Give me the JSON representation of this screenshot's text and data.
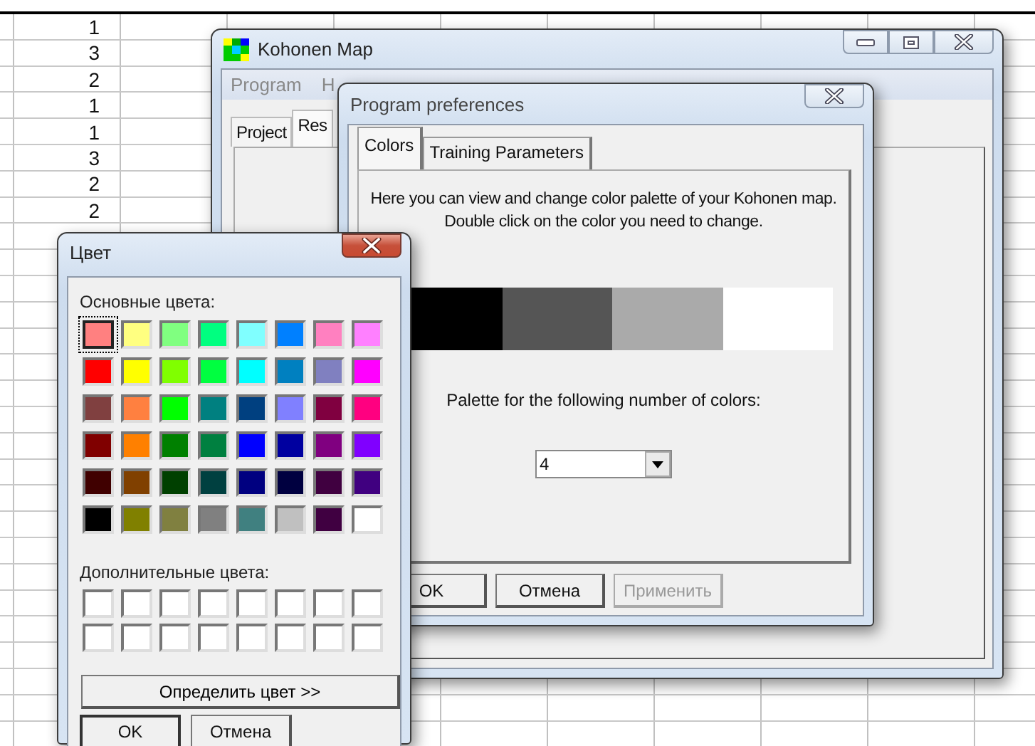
{
  "sheet": {
    "cells": [
      "1",
      "3",
      "2",
      "1",
      "1",
      "3",
      "2",
      "2"
    ]
  },
  "main_window": {
    "title": "Kohonen Map",
    "menu": [
      {
        "label": "Program"
      },
      {
        "label": "H"
      }
    ],
    "tabs": [
      {
        "label": "Project",
        "selected": false
      },
      {
        "label": "Res",
        "selected": true
      }
    ]
  },
  "preferences": {
    "title": "Program preferences",
    "tabs": [
      {
        "label": "Colors",
        "selected": true
      },
      {
        "label": "Training Parameters",
        "selected": false
      }
    ],
    "description": "Here you can view and change color palette of your Kohonen map. Double click on the color you need to change.",
    "palette": [
      {
        "color": "#000000"
      },
      {
        "color": "#555555"
      },
      {
        "color": "#aaaaaa"
      },
      {
        "color": "#ffffff"
      }
    ],
    "count_label": "Palette for the following number of colors:",
    "count_select": {
      "value": "4"
    },
    "buttons": [
      {
        "label": "OK",
        "disabled": false
      },
      {
        "label": "Отмена",
        "disabled": false
      },
      {
        "label": "Применить",
        "disabled": true
      }
    ]
  },
  "color_dialog": {
    "title": "Цвет",
    "basic_label": "Основные цвета:",
    "basic_colors": [
      {
        "color": "#ff8080",
        "selected": true
      },
      {
        "color": "#ffff80",
        "selected": false
      },
      {
        "color": "#80ff80",
        "selected": false
      },
      {
        "color": "#00ff80",
        "selected": false
      },
      {
        "color": "#80ffff",
        "selected": false
      },
      {
        "color": "#0080ff",
        "selected": false
      },
      {
        "color": "#ff80c0",
        "selected": false
      },
      {
        "color": "#ff80ff",
        "selected": false
      },
      {
        "color": "#ff0000",
        "selected": false
      },
      {
        "color": "#ffff00",
        "selected": false
      },
      {
        "color": "#80ff00",
        "selected": false
      },
      {
        "color": "#00ff40",
        "selected": false
      },
      {
        "color": "#00ffff",
        "selected": false
      },
      {
        "color": "#0080c0",
        "selected": false
      },
      {
        "color": "#8080c0",
        "selected": false
      },
      {
        "color": "#ff00ff",
        "selected": false
      },
      {
        "color": "#804040",
        "selected": false
      },
      {
        "color": "#ff8040",
        "selected": false
      },
      {
        "color": "#00ff00",
        "selected": false
      },
      {
        "color": "#008080",
        "selected": false
      },
      {
        "color": "#004080",
        "selected": false
      },
      {
        "color": "#8080ff",
        "selected": false
      },
      {
        "color": "#800040",
        "selected": false
      },
      {
        "color": "#ff0080",
        "selected": false
      },
      {
        "color": "#800000",
        "selected": false
      },
      {
        "color": "#ff8000",
        "selected": false
      },
      {
        "color": "#008000",
        "selected": false
      },
      {
        "color": "#008040",
        "selected": false
      },
      {
        "color": "#0000ff",
        "selected": false
      },
      {
        "color": "#0000a0",
        "selected": false
      },
      {
        "color": "#800080",
        "selected": false
      },
      {
        "color": "#8000ff",
        "selected": false
      },
      {
        "color": "#400000",
        "selected": false
      },
      {
        "color": "#804000",
        "selected": false
      },
      {
        "color": "#004000",
        "selected": false
      },
      {
        "color": "#004040",
        "selected": false
      },
      {
        "color": "#000080",
        "selected": false
      },
      {
        "color": "#000040",
        "selected": false
      },
      {
        "color": "#400040",
        "selected": false
      },
      {
        "color": "#400080",
        "selected": false
      },
      {
        "color": "#000000",
        "selected": false
      },
      {
        "color": "#808000",
        "selected": false
      },
      {
        "color": "#808040",
        "selected": false
      },
      {
        "color": "#808080",
        "selected": false
      },
      {
        "color": "#408080",
        "selected": false
      },
      {
        "color": "#c0c0c0",
        "selected": false
      },
      {
        "color": "#400041",
        "selected": false
      },
      {
        "color": "#ffffff",
        "selected": false
      }
    ],
    "custom_label": "Дополнительные цвета:",
    "custom_colors": [
      {
        "color": "#ffffff"
      },
      {
        "color": "#ffffff"
      },
      {
        "color": "#ffffff"
      },
      {
        "color": "#ffffff"
      },
      {
        "color": "#ffffff"
      },
      {
        "color": "#ffffff"
      },
      {
        "color": "#ffffff"
      },
      {
        "color": "#ffffff"
      },
      {
        "color": "#ffffff"
      },
      {
        "color": "#ffffff"
      },
      {
        "color": "#ffffff"
      },
      {
        "color": "#ffffff"
      },
      {
        "color": "#ffffff"
      },
      {
        "color": "#ffffff"
      },
      {
        "color": "#ffffff"
      },
      {
        "color": "#ffffff"
      }
    ],
    "define_button": "Определить цвет >>",
    "buttons": [
      {
        "label": "OK"
      },
      {
        "label": "Отмена"
      }
    ]
  }
}
